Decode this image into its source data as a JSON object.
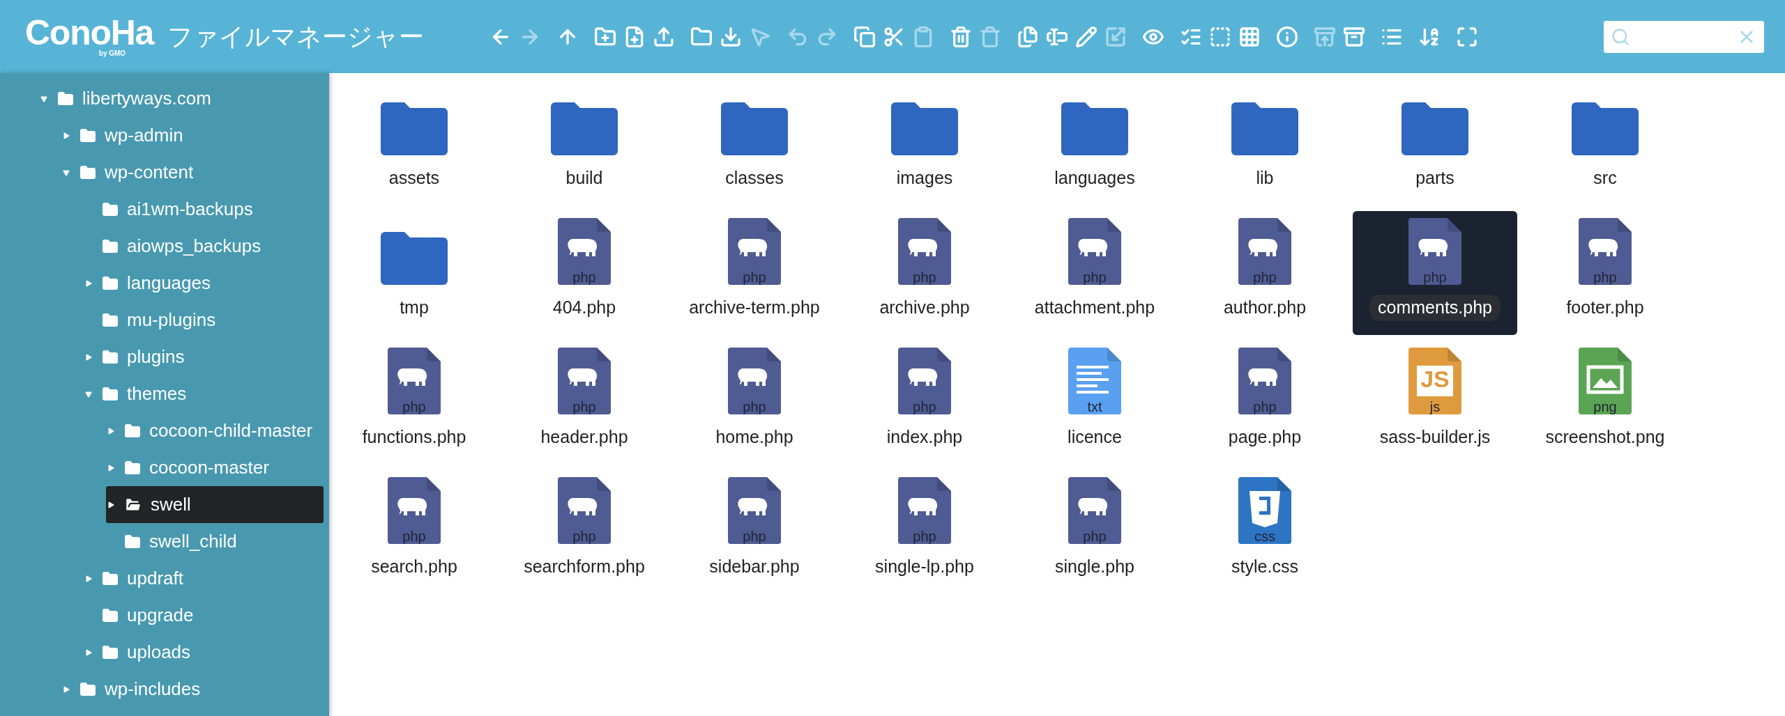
{
  "header": {
    "logo": "ConoHa",
    "logo_sub": "by GMO",
    "title": "ファイルマネージャー"
  },
  "toolbar": [
    {
      "kind": "back",
      "disabled": false
    },
    {
      "kind": "forward",
      "disabled": true
    },
    {
      "kind": "up",
      "disabled": false
    },
    {
      "kind": "new-folder",
      "disabled": false
    },
    {
      "kind": "new-file",
      "disabled": false
    },
    {
      "kind": "upload",
      "disabled": false
    },
    {
      "kind": "open",
      "disabled": false
    },
    {
      "kind": "download",
      "disabled": false
    },
    {
      "kind": "pointer",
      "disabled": true
    },
    {
      "kind": "undo",
      "disabled": true
    },
    {
      "kind": "redo",
      "disabled": true
    },
    {
      "kind": "copy",
      "disabled": false
    },
    {
      "kind": "cut",
      "disabled": false
    },
    {
      "kind": "paste",
      "disabled": true
    },
    {
      "kind": "delete",
      "disabled": false
    },
    {
      "kind": "empty",
      "disabled": true
    },
    {
      "kind": "duplicate",
      "disabled": false
    },
    {
      "kind": "rename",
      "disabled": false
    },
    {
      "kind": "edit",
      "disabled": false
    },
    {
      "kind": "resize",
      "disabled": true
    },
    {
      "kind": "preview",
      "disabled": false
    },
    {
      "kind": "select-all",
      "disabled": false
    },
    {
      "kind": "select-none",
      "disabled": false
    },
    {
      "kind": "select-invert",
      "disabled": false
    },
    {
      "kind": "info",
      "disabled": false
    },
    {
      "kind": "extract",
      "disabled": true
    },
    {
      "kind": "archive",
      "disabled": false
    },
    {
      "kind": "view",
      "disabled": false
    },
    {
      "kind": "sort",
      "disabled": false
    },
    {
      "kind": "fullscreen",
      "disabled": false
    }
  ],
  "sidebar": {
    "tree": [
      {
        "name": "libertyways.com",
        "has_children": true,
        "expanded": true,
        "selected": false,
        "children": [
          {
            "name": "wp-admin",
            "has_children": true,
            "expanded": false,
            "selected": false
          },
          {
            "name": "wp-content",
            "has_children": true,
            "expanded": true,
            "selected": false,
            "children": [
              {
                "name": "ai1wm-backups",
                "has_children": false,
                "expanded": false,
                "selected": false
              },
              {
                "name": "aiowps_backups",
                "has_children": false,
                "expanded": false,
                "selected": false
              },
              {
                "name": "languages",
                "has_children": true,
                "expanded": false,
                "selected": false
              },
              {
                "name": "mu-plugins",
                "has_children": false,
                "expanded": false,
                "selected": false
              },
              {
                "name": "plugins",
                "has_children": true,
                "expanded": false,
                "selected": false
              },
              {
                "name": "themes",
                "has_children": true,
                "expanded": true,
                "selected": false,
                "children": [
                  {
                    "name": "cocoon-child-master",
                    "has_children": true,
                    "expanded": false,
                    "selected": false
                  },
                  {
                    "name": "cocoon-master",
                    "has_children": true,
                    "expanded": false,
                    "selected": false
                  },
                  {
                    "name": "swell",
                    "has_children": true,
                    "expanded": false,
                    "selected": true
                  },
                  {
                    "name": "swell_child",
                    "has_children": false,
                    "expanded": false,
                    "selected": false
                  }
                ]
              },
              {
                "name": "updraft",
                "has_children": true,
                "expanded": false,
                "selected": false
              },
              {
                "name": "upgrade",
                "has_children": false,
                "expanded": false,
                "selected": false
              },
              {
                "name": "uploads",
                "has_children": true,
                "expanded": false,
                "selected": false
              }
            ]
          },
          {
            "name": "wp-includes",
            "has_children": true,
            "expanded": false,
            "selected": false
          }
        ]
      }
    ]
  },
  "files": [
    {
      "name": "assets",
      "kind": "folder",
      "selected": false
    },
    {
      "name": "build",
      "kind": "folder",
      "selected": false
    },
    {
      "name": "classes",
      "kind": "folder",
      "selected": false
    },
    {
      "name": "images",
      "kind": "folder",
      "selected": false
    },
    {
      "name": "languages",
      "kind": "folder",
      "selected": false
    },
    {
      "name": "lib",
      "kind": "folder",
      "selected": false
    },
    {
      "name": "parts",
      "kind": "folder",
      "selected": false
    },
    {
      "name": "src",
      "kind": "folder",
      "selected": false
    },
    {
      "name": "tmp",
      "kind": "folder",
      "selected": false
    },
    {
      "name": "404.php",
      "kind": "php",
      "badge": "php",
      "selected": false
    },
    {
      "name": "archive-term.php",
      "kind": "php",
      "badge": "php",
      "selected": false
    },
    {
      "name": "archive.php",
      "kind": "php",
      "badge": "php",
      "selected": false
    },
    {
      "name": "attachment.php",
      "kind": "php",
      "badge": "php",
      "selected": false
    },
    {
      "name": "author.php",
      "kind": "php",
      "badge": "php",
      "selected": false
    },
    {
      "name": "comments.php",
      "kind": "php",
      "badge": "php",
      "selected": true
    },
    {
      "name": "footer.php",
      "kind": "php",
      "badge": "php",
      "selected": false
    },
    {
      "name": "functions.php",
      "kind": "php",
      "badge": "php",
      "selected": false
    },
    {
      "name": "header.php",
      "kind": "php",
      "badge": "php",
      "selected": false
    },
    {
      "name": "home.php",
      "kind": "php",
      "badge": "php",
      "selected": false
    },
    {
      "name": "index.php",
      "kind": "php",
      "badge": "php",
      "selected": false
    },
    {
      "name": "licence",
      "kind": "txt",
      "badge": "txt",
      "selected": false
    },
    {
      "name": "page.php",
      "kind": "php",
      "badge": "php",
      "selected": false
    },
    {
      "name": "sass-builder.js",
      "kind": "js",
      "badge": "js",
      "logo": "JS",
      "selected": false
    },
    {
      "name": "screenshot.png",
      "kind": "png",
      "badge": "png",
      "selected": false
    },
    {
      "name": "search.php",
      "kind": "php",
      "badge": "php",
      "selected": false
    },
    {
      "name": "searchform.php",
      "kind": "php",
      "badge": "php",
      "selected": false
    },
    {
      "name": "sidebar.php",
      "kind": "php",
      "badge": "php",
      "selected": false
    },
    {
      "name": "single-lp.php",
      "kind": "php",
      "badge": "php",
      "selected": false
    },
    {
      "name": "single.php",
      "kind": "php",
      "badge": "php",
      "selected": false
    },
    {
      "name": "style.css",
      "kind": "css",
      "badge": "css",
      "selected": false
    }
  ]
}
